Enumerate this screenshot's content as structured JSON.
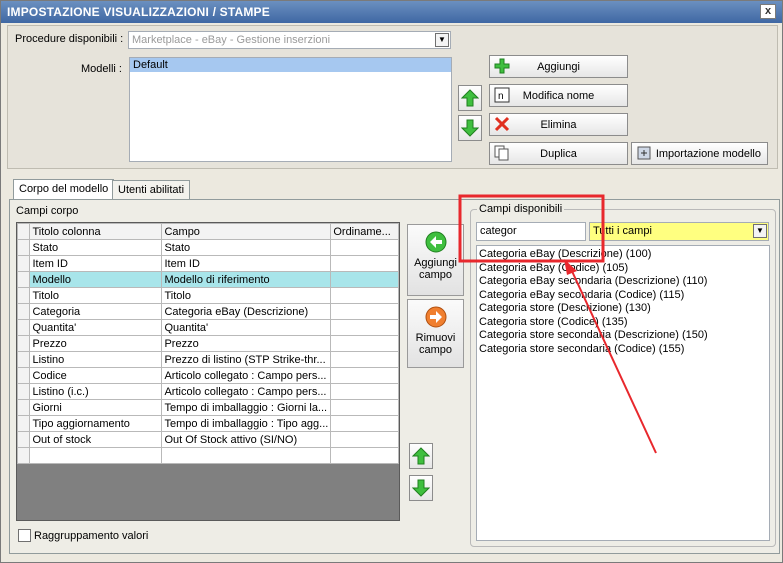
{
  "window": {
    "title": "IMPOSTAZIONE VISUALIZZAZIONI / STAMPE",
    "close_glyph": "x"
  },
  "procedure": {
    "label": "Procedure disponibili",
    "value": "Marketplace - eBay - Gestione inserzioni"
  },
  "modelli": {
    "label": "Modelli",
    "items": [
      "Default"
    ],
    "selected": "Default"
  },
  "buttons": {
    "aggiungi": "Aggiungi",
    "modifica_nome": "Modifica nome",
    "elimina": "Elimina",
    "duplica": "Duplica",
    "importazione": "Importazione modello"
  },
  "tabs": [
    "Corpo del modello",
    "Utenti abilitati"
  ],
  "campi_corpo": {
    "label": "Campi corpo",
    "columns": [
      "Titolo colonna",
      "Campo",
      "Ordiname..."
    ],
    "rows": [
      [
        "Stato",
        "Stato"
      ],
      [
        "Item ID",
        "Item ID"
      ],
      [
        "Modello",
        "Modello di riferimento"
      ],
      [
        "Titolo",
        "Titolo"
      ],
      [
        "Categoria",
        "Categoria eBay (Descrizione)"
      ],
      [
        "Quantita'",
        "Quantita'"
      ],
      [
        "Prezzo",
        "Prezzo"
      ],
      [
        "Listino",
        "Prezzo di listino (STP Strike-thr..."
      ],
      [
        "Codice",
        "Articolo collegato : Campo pers..."
      ],
      [
        "Listino (i.c.)",
        "Articolo collegato : Campo pers..."
      ],
      [
        "Giorni",
        "Tempo di imballaggio : Giorni la..."
      ],
      [
        "Tipo aggiornamento",
        "Tempo di imballaggio : Tipo agg..."
      ],
      [
        "Out of stock",
        "Out Of Stock attivo (SI/NO)"
      ]
    ],
    "highlighted_row": "Modello"
  },
  "field_buttons": {
    "aggiungi": "Aggiungi campo",
    "rimuovi": "Rimuovi campo"
  },
  "campi_disponibili": {
    "label": "Campi disponibili",
    "search_value": "categor",
    "filter_value": "Tutti i campi",
    "items": [
      "Categoria eBay (Descrizione) (100)",
      "Categoria eBay (Codice) (105)",
      "Categoria eBay secondaria (Descrizione) (110)",
      "Categoria eBay secondaria (Codice) (115)",
      "Categoria store (Descrizione) (130)",
      "Categoria store (Codice) (135)",
      "Categoria store secondaria (Descrizione) (150)",
      "Categoria store secondaria (Codice) (155)"
    ]
  },
  "raggruppamento": {
    "label": "Raggruppamento valori",
    "checked": false
  },
  "colors": {
    "titlebar": "#4f76b0",
    "highlight_row": "#a8e5ea",
    "filter_yellow": "#ffff80",
    "annotation_red": "#e8282d"
  }
}
